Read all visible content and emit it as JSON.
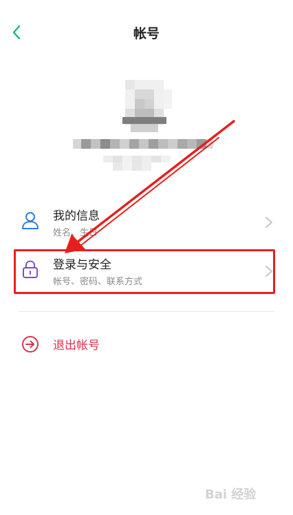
{
  "header": {
    "title": "帐号",
    "back_icon": "chevron-left-icon"
  },
  "profile": {
    "avatar": "pixelated-avatar",
    "name": "",
    "account_id": ""
  },
  "menu": {
    "items": [
      {
        "title": "我的信息",
        "subtitle": "姓名、生日",
        "icon": "person-icon",
        "icon_color": "#2b7fd9"
      },
      {
        "title": "登录与安全",
        "subtitle": "帐号、密码、联系方式",
        "icon": "lock-icon",
        "icon_color": "#7a4fc4"
      }
    ]
  },
  "logout": {
    "label": "退出帐号",
    "icon": "logout-circle-arrow-icon",
    "color": "#d9324a"
  },
  "annotation": {
    "highlight_color": "#e5201c"
  },
  "watermark": {
    "text": "Bai 经验"
  },
  "colors": {
    "accent_green": "#19b08a",
    "chevron": "#bdbdbd"
  }
}
